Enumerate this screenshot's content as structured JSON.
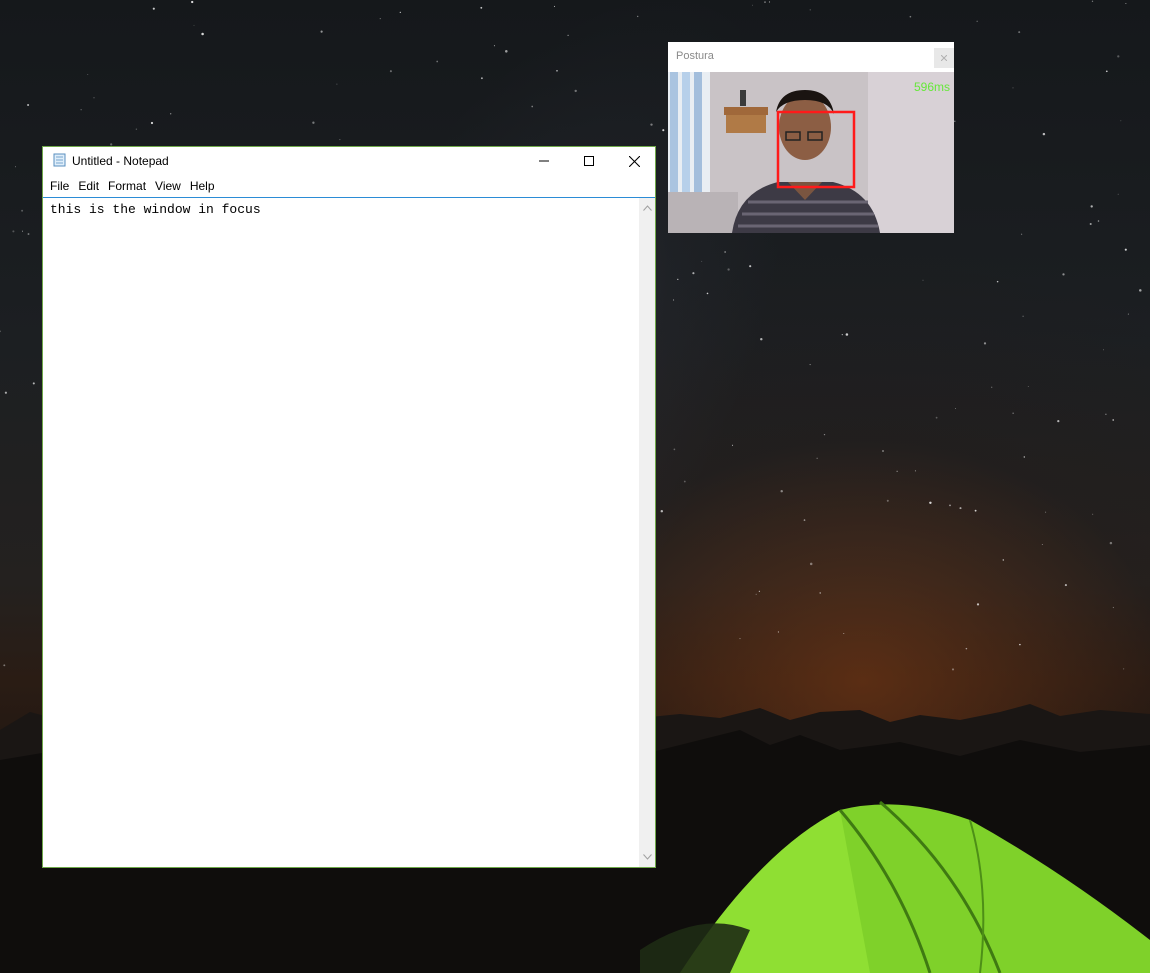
{
  "desktop": {
    "wallpaper": "night-sky-with-green-tent"
  },
  "notepad": {
    "title": "Untitled - Notepad",
    "app_icon": "notepad-icon",
    "controls": {
      "minimize": "minimize-icon",
      "maximize": "maximize-icon",
      "close": "close-icon"
    },
    "menu": [
      "File",
      "Edit",
      "Format",
      "View",
      "Help"
    ],
    "content": "this is the window in focus",
    "focused": true
  },
  "postura": {
    "title": "Postura",
    "latency": "596ms",
    "face_box_color": "#ff1a1a",
    "latency_color": "#66e83a"
  },
  "colors": {
    "focus_border": "#6fa84a",
    "editor_border": "#2b8cd6"
  }
}
